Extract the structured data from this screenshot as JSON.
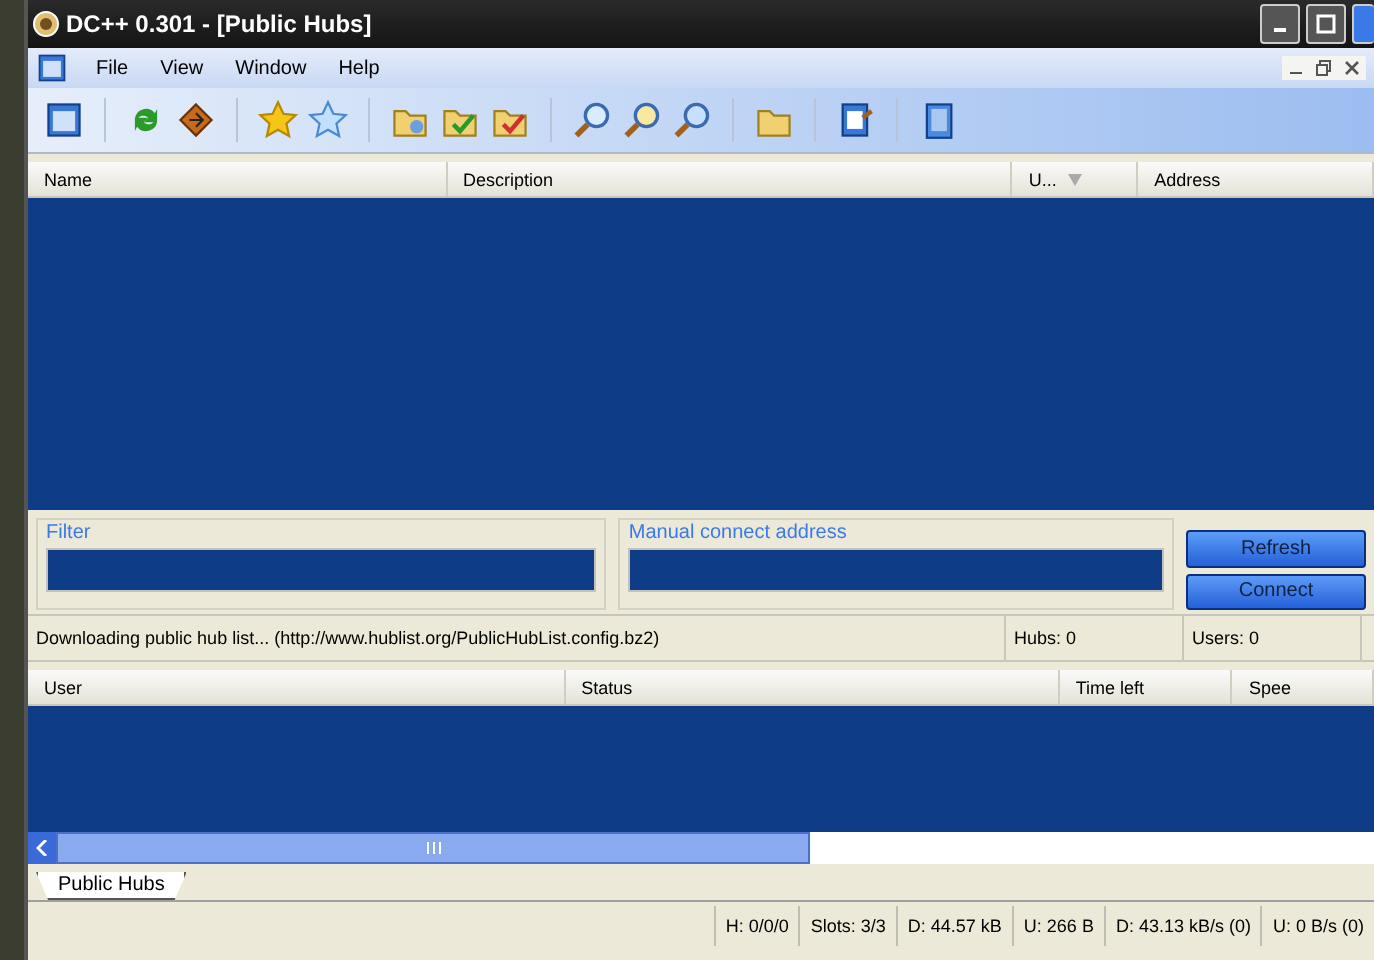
{
  "window": {
    "title": "DC++ 0.301 - [Public Hubs]"
  },
  "menu": [
    "File",
    "View",
    "Window",
    "Help"
  ],
  "hubs_table": {
    "columns": [
      "Name",
      "Description",
      "U...",
      "Address"
    ]
  },
  "filter": {
    "label": "Filter"
  },
  "manual_connect": {
    "label": "Manual connect address"
  },
  "buttons": [
    "Refresh",
    "Connect"
  ],
  "hub_status": [
    "Downloading public hub list... (http://www.hublist.org/PublicHubList.config.bz2)",
    "Hubs: 0",
    "Users: 0"
  ],
  "transfers_table": {
    "columns": [
      "User",
      "Status",
      "Time left",
      "Spee"
    ]
  },
  "tabs": [
    {
      "label": "Public Hubs",
      "selected": true
    }
  ],
  "status_bar": [
    "H: 0/0/0",
    "Slots: 3/3",
    "D: 44.57 kB",
    "U: 266 B",
    "D: 43.13 kB/s (0)",
    "U: 0 B/s (0)"
  ]
}
